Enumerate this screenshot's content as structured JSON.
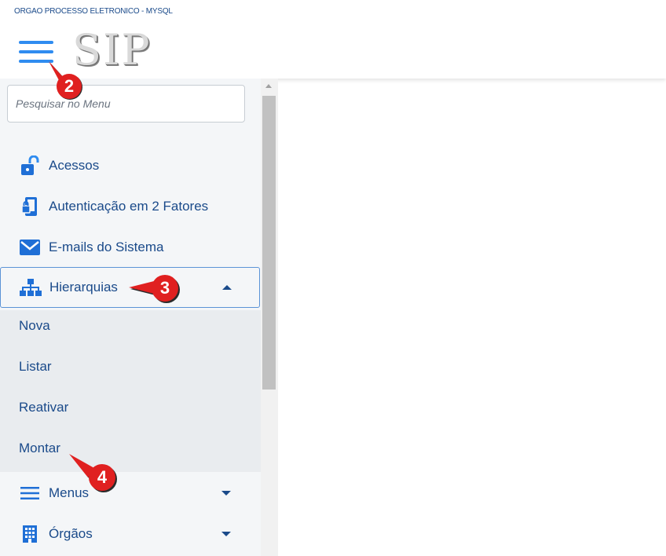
{
  "org_title": "ORGAO PROCESSO ELETRONICO - MYSQL",
  "logo": "SIP",
  "search": {
    "placeholder": "Pesquisar no Menu"
  },
  "menu": {
    "acessos": "Acessos",
    "autenticacao": "Autenticação em 2 Fatores",
    "emails": "E-mails do Sistema",
    "hierarquias": "Hierarquias",
    "menus": "Menus",
    "orgaos": "Órgãos"
  },
  "submenu": [
    "Nova",
    "Listar",
    "Reativar",
    "Montar"
  ],
  "callouts": [
    "2",
    "3",
    "4"
  ],
  "colors": {
    "accent": "#2f8cf0",
    "text": "#1a4a8a",
    "callout": "#e02020"
  }
}
